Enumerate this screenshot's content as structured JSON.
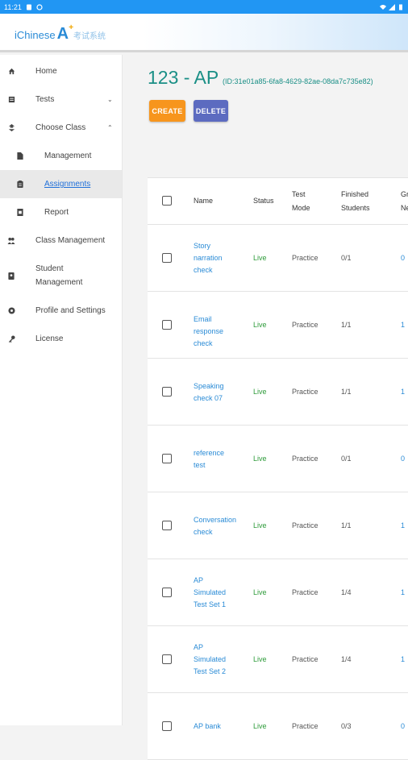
{
  "status_bar": {
    "time": "11:21"
  },
  "logo": {
    "brand": "iChinese",
    "mark": "A",
    "cn": "考试系统"
  },
  "sidebar": {
    "items": [
      {
        "label": "Home",
        "icon": "home-icon"
      },
      {
        "label": "Tests",
        "icon": "list-icon",
        "chevron": "⌄"
      },
      {
        "label": "Choose Class",
        "icon": "swap-icon",
        "chevron": "⌃"
      },
      {
        "label": "Management",
        "icon": "document-icon"
      },
      {
        "label": "Assignments",
        "icon": "clipboard-icon"
      },
      {
        "label": "Report",
        "icon": "report-icon"
      },
      {
        "label": "Class Management",
        "icon": "group-icon"
      },
      {
        "label": "Student Management",
        "icon": "student-icon"
      },
      {
        "label": "Profile and Settings",
        "icon": "settings-icon"
      },
      {
        "label": "License",
        "icon": "key-icon"
      }
    ]
  },
  "page": {
    "title": "123 - AP",
    "id_text": "(ID:31e01a85-6fa8-4629-82ae-08da7c735e82)",
    "create_label": "CREATE",
    "delete_label": "DELETE"
  },
  "table": {
    "headers": {
      "name": "Name",
      "status": "Status",
      "test_mode": "Test Mode",
      "finished": "Finished Students",
      "grade": "Gr Ne"
    },
    "rows": [
      {
        "name": "Story narration check",
        "status": "Live",
        "mode": "Practice",
        "finished": "0/1",
        "grade": "0"
      },
      {
        "name": "Email response check",
        "status": "Live",
        "mode": "Practice",
        "finished": "1/1",
        "grade": "1"
      },
      {
        "name": "Speaking check 07",
        "status": "Live",
        "mode": "Practice",
        "finished": "1/1",
        "grade": "1"
      },
      {
        "name": "reference test",
        "status": "Live",
        "mode": "Practice",
        "finished": "0/1",
        "grade": "0"
      },
      {
        "name": "Conversation check",
        "status": "Live",
        "mode": "Practice",
        "finished": "1/1",
        "grade": "1"
      },
      {
        "name": "AP Simulated Test Set 1",
        "status": "Live",
        "mode": "Practice",
        "finished": "1/4",
        "grade": "1"
      },
      {
        "name": "AP Simulated Test Set 2",
        "status": "Live",
        "mode": "Practice",
        "finished": "1/4",
        "grade": "1"
      },
      {
        "name": "AP bank",
        "status": "Live",
        "mode": "Practice",
        "finished": "0/3",
        "grade": "0"
      }
    ]
  },
  "colors": {
    "accent_blue": "#2196f3",
    "title_teal": "#1a8f86",
    "create_orange": "#f7951d",
    "delete_indigo": "#5c6bc0",
    "live_green": "#2e9b3a",
    "link_blue": "#2a8bd6"
  }
}
